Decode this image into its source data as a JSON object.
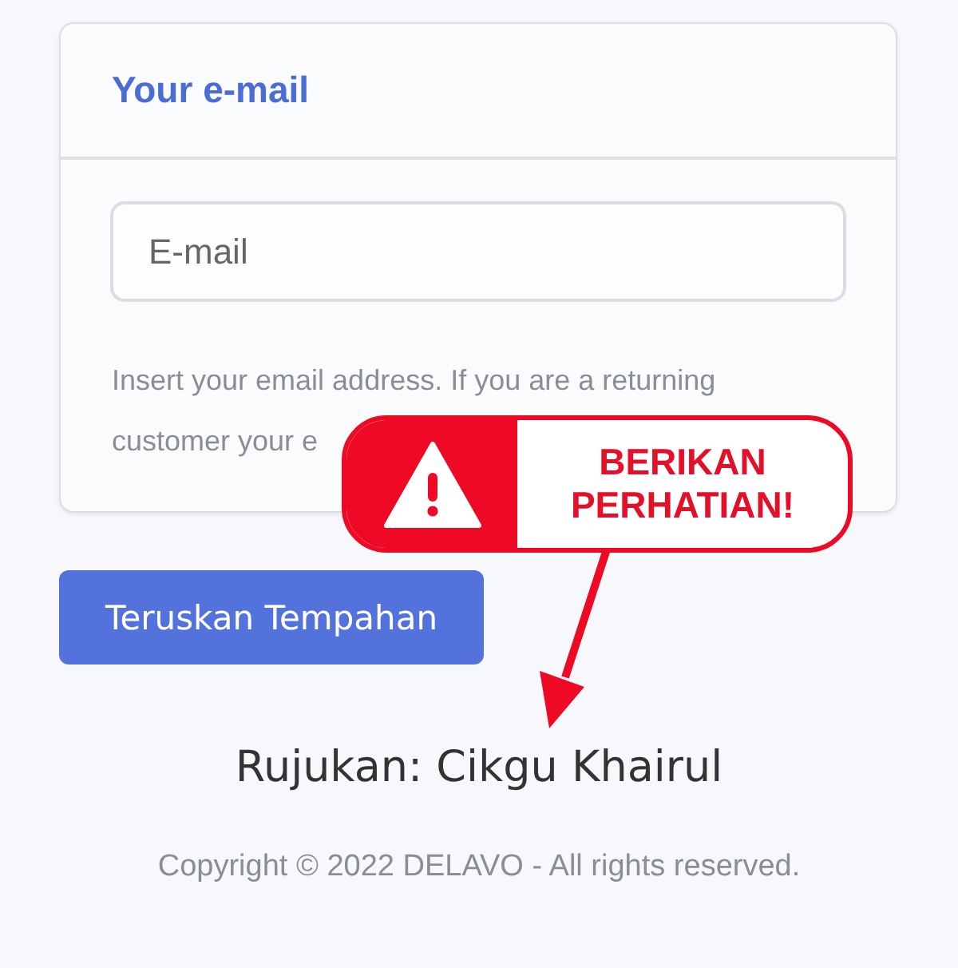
{
  "email_card": {
    "title": "Your e-mail",
    "field": {
      "placeholder": "E-mail"
    },
    "hint_lines": [
      "Insert your email address. If you are a returning",
      "customer your e"
    ]
  },
  "callout": {
    "text": "BERIKAN PERHATIAN!"
  },
  "submit_button": "Teruskan Tempahan",
  "referral": "Rujukan: Cikgu Khairul",
  "copyright": "Copyright © 2022 DELAVO - All rights reserved."
}
